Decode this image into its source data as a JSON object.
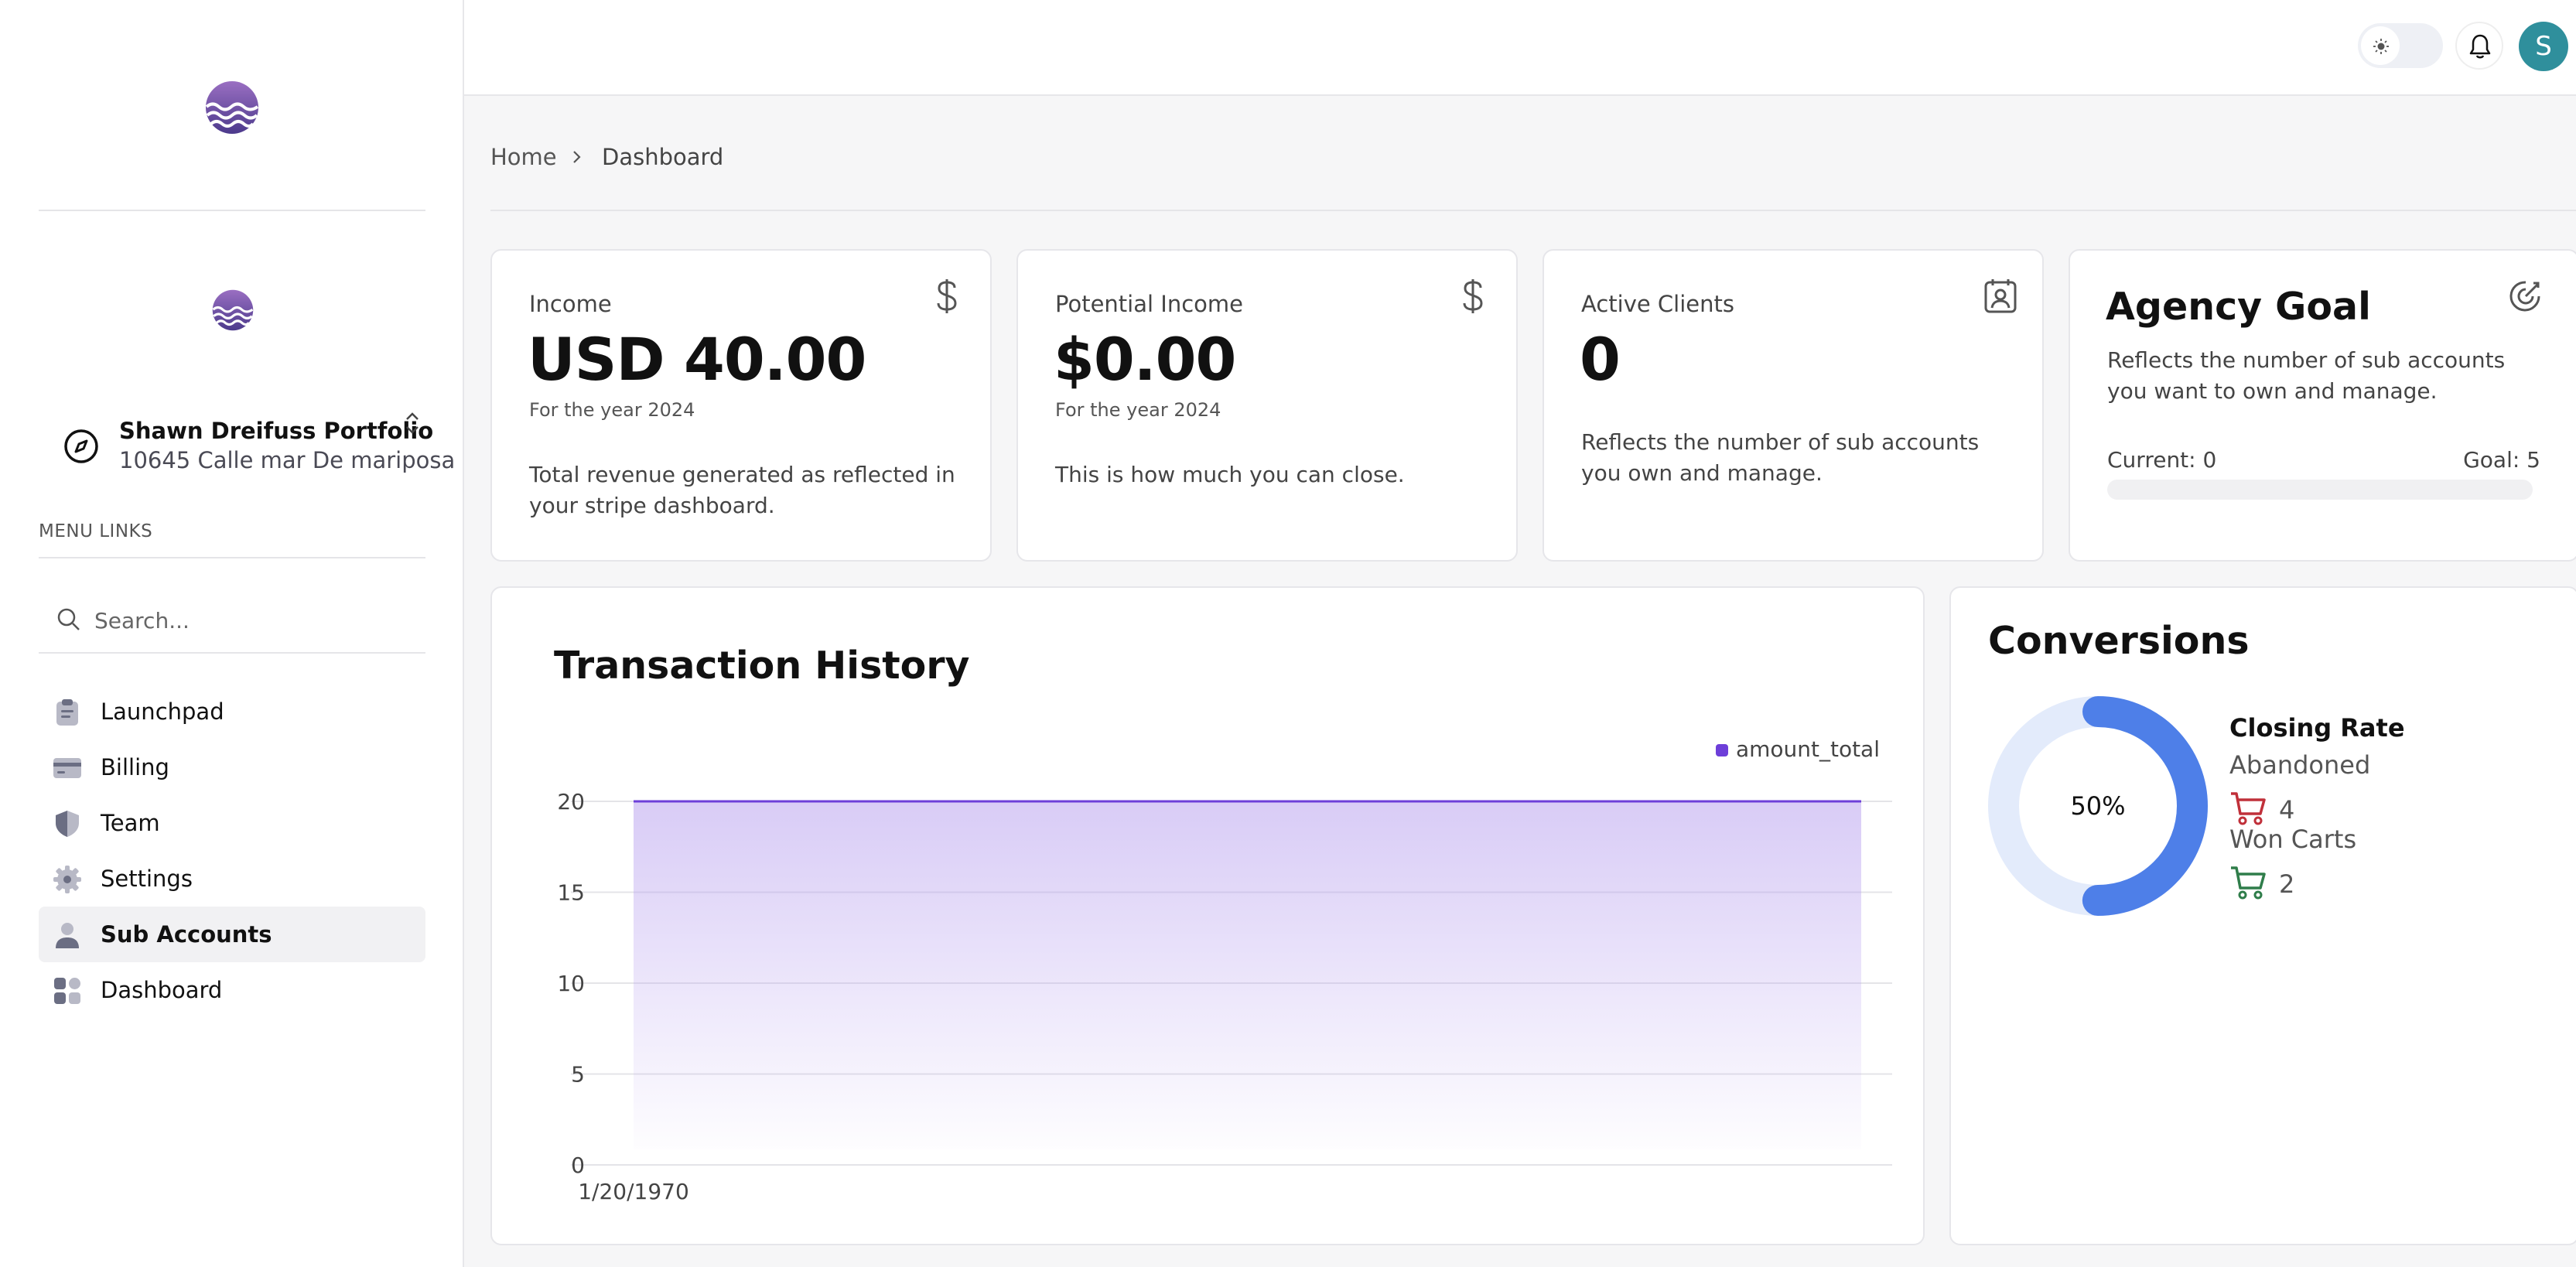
{
  "sidebar": {
    "account_name": "Shawn Dreifuss Portfolio",
    "account_address": "10645 Calle mar De mariposa",
    "menu_heading": "MENU LINKS",
    "search_placeholder": "Search...",
    "items": [
      {
        "label": "Launchpad",
        "icon": "clipboard-icon"
      },
      {
        "label": "Billing",
        "icon": "credit-card-icon"
      },
      {
        "label": "Team",
        "icon": "shield-icon"
      },
      {
        "label": "Settings",
        "icon": "gear-icon"
      },
      {
        "label": "Sub Accounts",
        "icon": "person-icon",
        "active": true
      },
      {
        "label": "Dashboard",
        "icon": "grid-icon"
      }
    ]
  },
  "topbar": {
    "avatar_initial": "S"
  },
  "breadcrumb": {
    "home": "Home",
    "current": "Dashboard"
  },
  "cards": {
    "income": {
      "label": "Income",
      "value": "USD 40.00",
      "sub": "For the year 2024",
      "desc": "Total revenue generated as reflected in your stripe dashboard."
    },
    "potential": {
      "label": "Potential Income",
      "value": "$0.00",
      "sub": "For the year 2024",
      "desc": "This is how much you can close."
    },
    "clients": {
      "label": "Active Clients",
      "value": "0",
      "desc": "Reflects the number of sub accounts you own and manage."
    },
    "goal": {
      "title": "Agency Goal",
      "desc": "Reflects the number of sub accounts you want to own and manage.",
      "current_label": "Current: 0",
      "goal_label": "Goal: 5",
      "progress": 0
    }
  },
  "transactions": {
    "title": "Transaction History"
  },
  "chart_data": {
    "type": "area",
    "title": "Transaction History",
    "series": [
      {
        "name": "amount_total",
        "values": [
          20,
          20
        ]
      }
    ],
    "x": [
      "1/20/1970",
      ""
    ],
    "x_tick_labels": [
      "1/20/1970"
    ],
    "y_ticks": [
      "0",
      "5",
      "10",
      "15",
      "20"
    ],
    "ylim": [
      0,
      20
    ],
    "grid": true,
    "legend": "top-right",
    "color": "#6d3fd9"
  },
  "conversions": {
    "title": "Conversions",
    "rate_label": "50%",
    "rate": 0.5,
    "closing_rate": "Closing Rate",
    "abandoned_label": "Abandoned",
    "abandoned_count": "4",
    "won_label": "Won Carts",
    "won_count": "2",
    "colors": {
      "ring": "#4e7fe8",
      "track": "#e3ebfb",
      "abandoned": "#c0303a",
      "won": "#2f7d4a"
    }
  }
}
